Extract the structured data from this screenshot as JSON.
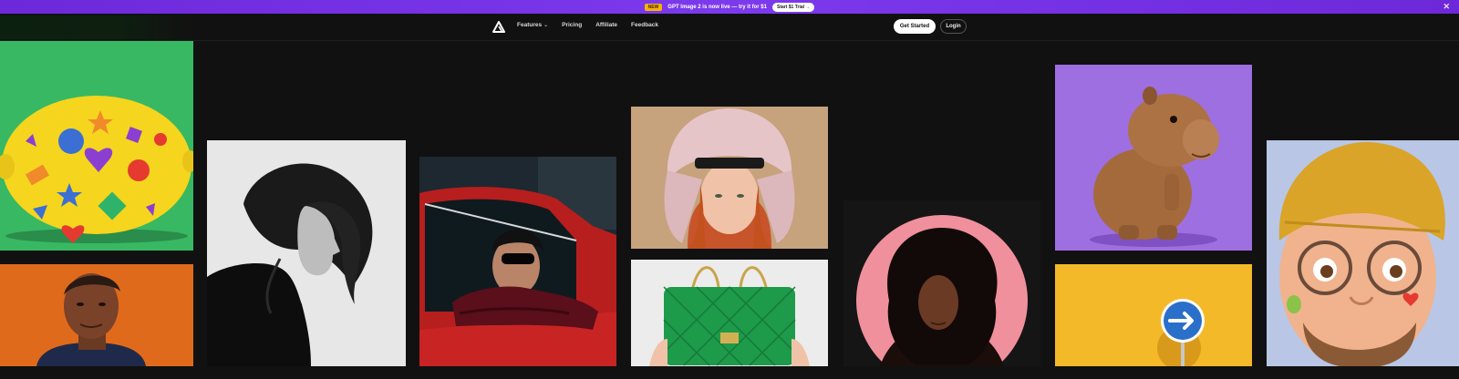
{
  "promo": {
    "badge": "NEW",
    "text": "GPT Image 2 is now live — try it for $1",
    "cta": "Start $1 Trial →",
    "close_glyph": "✕"
  },
  "nav": {
    "logo_icon": "triangle-logo-icon",
    "items": [
      {
        "label": "Features",
        "has_dropdown": true
      },
      {
        "label": "Pricing"
      },
      {
        "label": "Affiliate"
      },
      {
        "label": "Feedback"
      }
    ],
    "chevron_glyph": "⌄",
    "get_started": "Get Started",
    "login": "Login"
  },
  "gallery": {
    "tiles": [
      "lemon-with-stickers-image",
      "man-portrait-orange-image",
      "bw-woman-profile-image",
      "woman-red-car-image",
      "redhead-fur-hat-image",
      "green-quilted-bag-image",
      "woman-pink-circle-image",
      "capybara-figure-image",
      "road-sign-yellow-image",
      "cartoon-man-beanie-image"
    ]
  },
  "colors": {
    "banner": "#6d28d9",
    "badge": "#f5b301",
    "background": "#111111"
  }
}
